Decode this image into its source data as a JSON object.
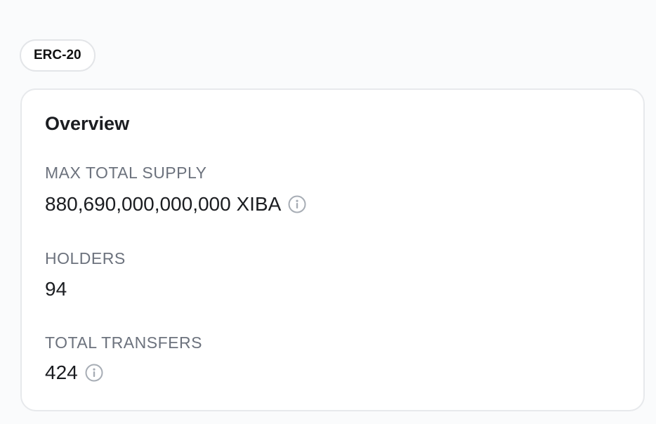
{
  "badge": {
    "label": "ERC-20"
  },
  "overview": {
    "title": "Overview",
    "max_total_supply": {
      "label": "MAX TOTAL SUPPLY",
      "value": "880,690,000,000,000 XIBA",
      "icon": "info-icon"
    },
    "holders": {
      "label": "HOLDERS",
      "value": "94"
    },
    "total_transfers": {
      "label": "TOTAL TRANSFERS",
      "value": "424",
      "icon": "info-icon"
    }
  },
  "colors": {
    "page_background": "#fafbfc",
    "card_background": "#ffffff",
    "border": "#e7e9ec",
    "label_text": "#6c727d",
    "value_text": "#1b1d21",
    "icon": "#a7adb5"
  }
}
